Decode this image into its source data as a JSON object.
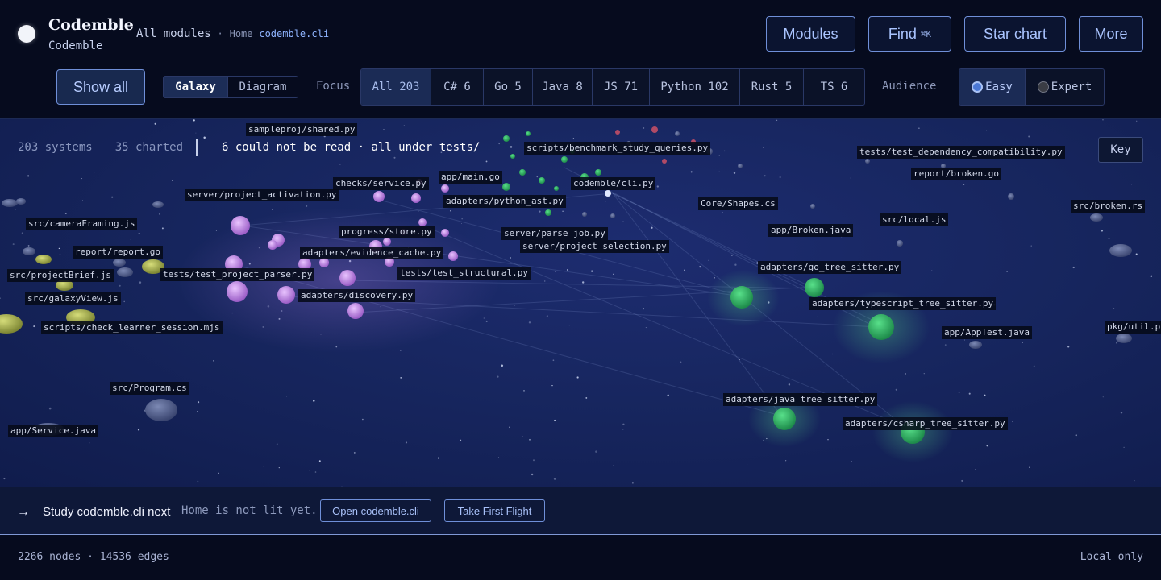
{
  "app": {
    "title": "Codemble",
    "subtitle": "Codemble"
  },
  "breadcrumb": {
    "scope": "All modules",
    "separator": "·",
    "home": "Home",
    "current": "codemble.cli"
  },
  "header_buttons": {
    "modules": "Modules",
    "find": "Find",
    "find_shortcut": "⌘K",
    "star_chart": "Star chart",
    "more": "More"
  },
  "toolbar": {
    "show_all": "Show all",
    "view_modes": [
      {
        "label": "Galaxy",
        "active": true
      },
      {
        "label": "Diagram",
        "active": false
      }
    ],
    "focus_label": "Focus",
    "focus_options": [
      {
        "label": "All 203",
        "active": true
      },
      {
        "label": "C# 6",
        "active": false
      },
      {
        "label": "Go 5",
        "active": false
      },
      {
        "label": "Java 8",
        "active": false
      },
      {
        "label": "JS 71",
        "active": false
      },
      {
        "label": "Python 102",
        "active": false
      },
      {
        "label": "Rust 5",
        "active": false
      },
      {
        "label": "TS 6",
        "active": false
      }
    ],
    "audience_label": "Audience",
    "audience_options": [
      {
        "label": "Easy",
        "active": true
      },
      {
        "label": "Expert",
        "active": false
      }
    ]
  },
  "galaxy": {
    "systems": "203 systems",
    "charted": "35 charted",
    "warning": "6 could not be read · all under tests/",
    "key_button": "Key",
    "labels": [
      "sampleproj/shared.py",
      "scripts/benchmark_study_queries.py",
      "tests/test_dependency_compatibility.py",
      "report/broken.go",
      "app/main.go",
      "checks/service.py",
      "codemble/cli.py",
      "server/project_activation.py",
      "adapters/python_ast.py",
      "Core/Shapes.cs",
      "src/broken.rs",
      "src/cameraFraming.js",
      "src/local.js",
      "progress/store.py",
      "server/parse_job.py",
      "app/Broken.java",
      "report/report.go",
      "adapters/evidence_cache.py",
      "server/project_selection.py",
      "adapters/go_tree_sitter.py",
      "src/projectBrief.js",
      "tests/test_project_parser.py",
      "tests/test_structural.py",
      "adapters/discovery.py",
      "src/galaxyView.js",
      "adapters/typescript_tree_sitter.py",
      "scripts/check_learner_session.mjs",
      "pkg/util.py",
      "app/AppTest.java",
      "src/Program.cs",
      "adapters/java_tree_sitter.py",
      "adapters/csharp_tree_sitter.py",
      "app/Service.java"
    ],
    "colors": {
      "python": "#c58be8",
      "js": "#a8b44a",
      "go": "#2f9b68",
      "ts": "#3bbd6a",
      "other": "#4b5a8a"
    }
  },
  "suggestion": {
    "arrow": "→",
    "title": "Study codemble.cli next",
    "note": "Home is not lit yet.",
    "open_button": "Open codemble.cli",
    "flight_button": "Take First Flight"
  },
  "footer": {
    "stats": "2266 nodes · 14536 edges",
    "mode": "Local only"
  }
}
